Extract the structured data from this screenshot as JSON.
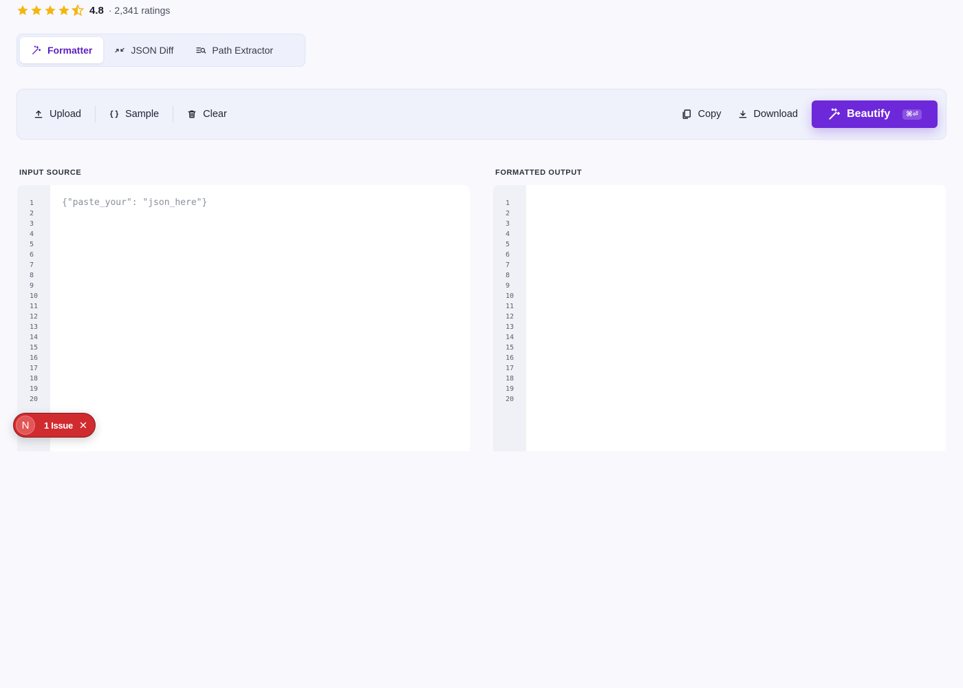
{
  "rating": {
    "value": "4.8",
    "count_text": "· 2,341 ratings",
    "stars": 4.5,
    "star_color": "#f5b50f"
  },
  "tabs": [
    {
      "label": "Formatter",
      "icon": "magic-wand-icon",
      "active": true
    },
    {
      "label": "JSON Diff",
      "icon": "compare-arrows-icon",
      "active": false
    },
    {
      "label": "Path Extractor",
      "icon": "list-search-icon",
      "active": false
    }
  ],
  "toolbar": {
    "upload_label": "Upload",
    "sample_label": "Sample",
    "clear_label": "Clear",
    "copy_label": "Copy",
    "download_label": "Download",
    "beautify_label": "Beautify",
    "beautify_shortcut": "⌘⏎",
    "accent_color": "#6d28d9"
  },
  "input": {
    "label": "INPUT SOURCE",
    "placeholder": "{\"paste_your\": \"json_here\"}",
    "value": "",
    "line_count": 20
  },
  "output": {
    "label": "FORMATTED OUTPUT",
    "value": "",
    "line_count": 20
  },
  "issue_badge": {
    "logo_letter": "N",
    "text": "1 Issue",
    "color": "#d02b2f"
  }
}
